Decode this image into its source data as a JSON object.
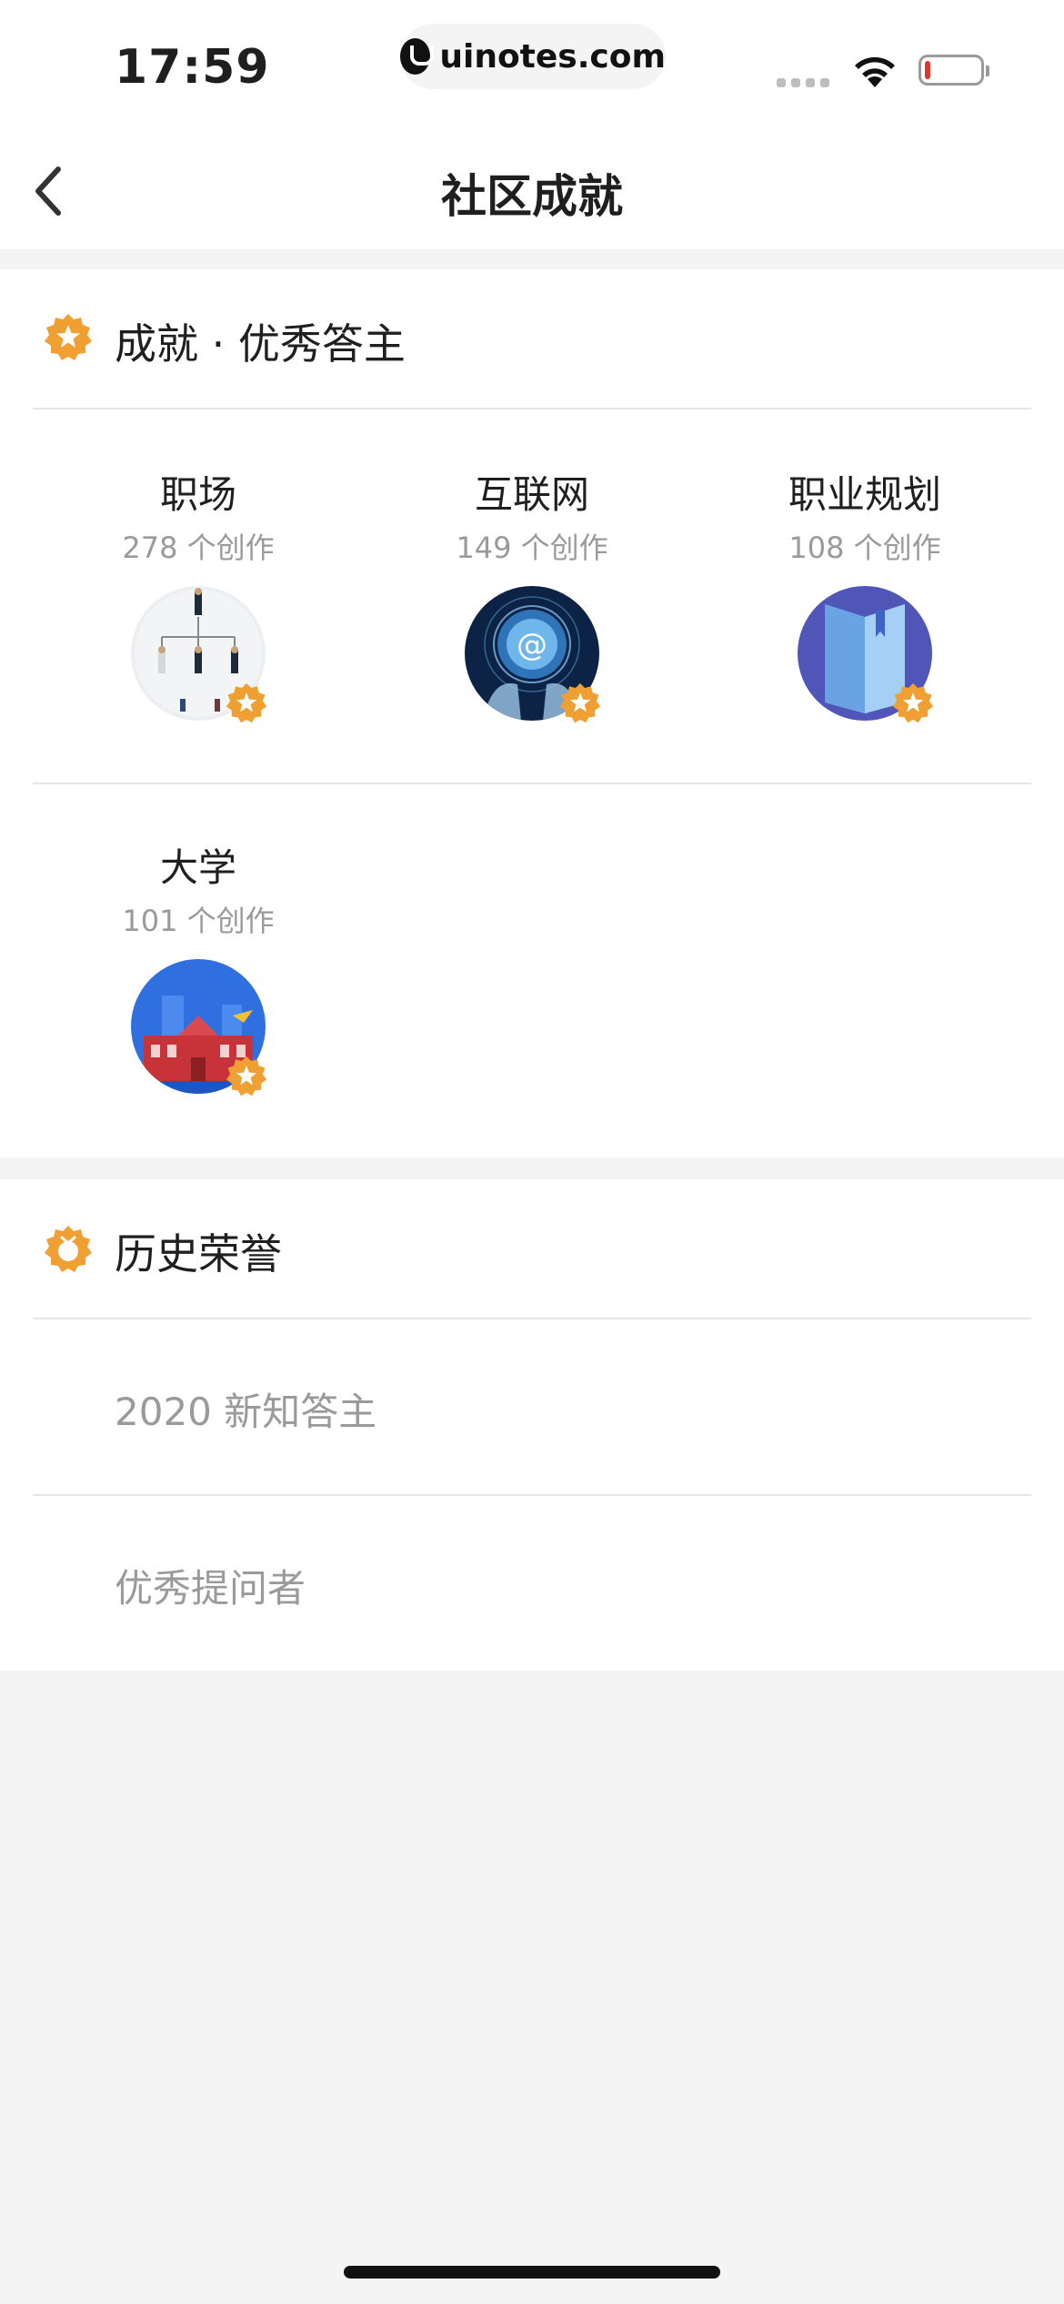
{
  "status_bar": {
    "time": "17:59",
    "url": "uinotes.com",
    "icons": [
      "signal-icon",
      "wifi-icon",
      "battery-icon"
    ]
  },
  "nav": {
    "back_icon": "chevron-left-icon",
    "title": "社区成就"
  },
  "achievements": {
    "icon": "star-badge-icon",
    "title": "成就 · 优秀答主",
    "topics": [
      {
        "name": "职场",
        "count": "278 个创作",
        "image": "workplace-org-chart-image"
      },
      {
        "name": "互联网",
        "count": "149 个创作",
        "image": "internet-globe-image"
      },
      {
        "name": "职业规划",
        "count": "108 个创作",
        "image": "career-book-image"
      },
      {
        "name": "大学",
        "count": "101 个创作",
        "image": "university-building-image"
      }
    ],
    "accent_color": "#f0a033"
  },
  "honors": {
    "icon": "medal-icon",
    "title": "历史荣誉",
    "items": [
      "2020 新知答主",
      "优秀提问者"
    ]
  }
}
